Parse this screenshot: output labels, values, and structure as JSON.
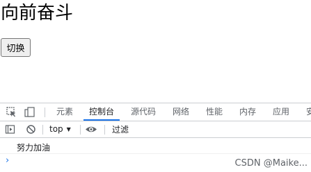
{
  "page": {
    "heading": "向前奋斗",
    "button_label": "切换"
  },
  "devtools": {
    "tabs": [
      {
        "label": "元素",
        "active": false
      },
      {
        "label": "控制台",
        "active": true
      },
      {
        "label": "源代码",
        "active": false
      },
      {
        "label": "网络",
        "active": false
      },
      {
        "label": "性能",
        "active": false
      },
      {
        "label": "内存",
        "active": false
      },
      {
        "label": "应用",
        "active": false
      },
      {
        "label": "安",
        "active": false
      }
    ],
    "toolbar": {
      "context": "top",
      "filter_placeholder": "过滤"
    },
    "console": {
      "messages": [
        "努力加油"
      ]
    }
  },
  "watermark": "CSDN @Maike..."
}
